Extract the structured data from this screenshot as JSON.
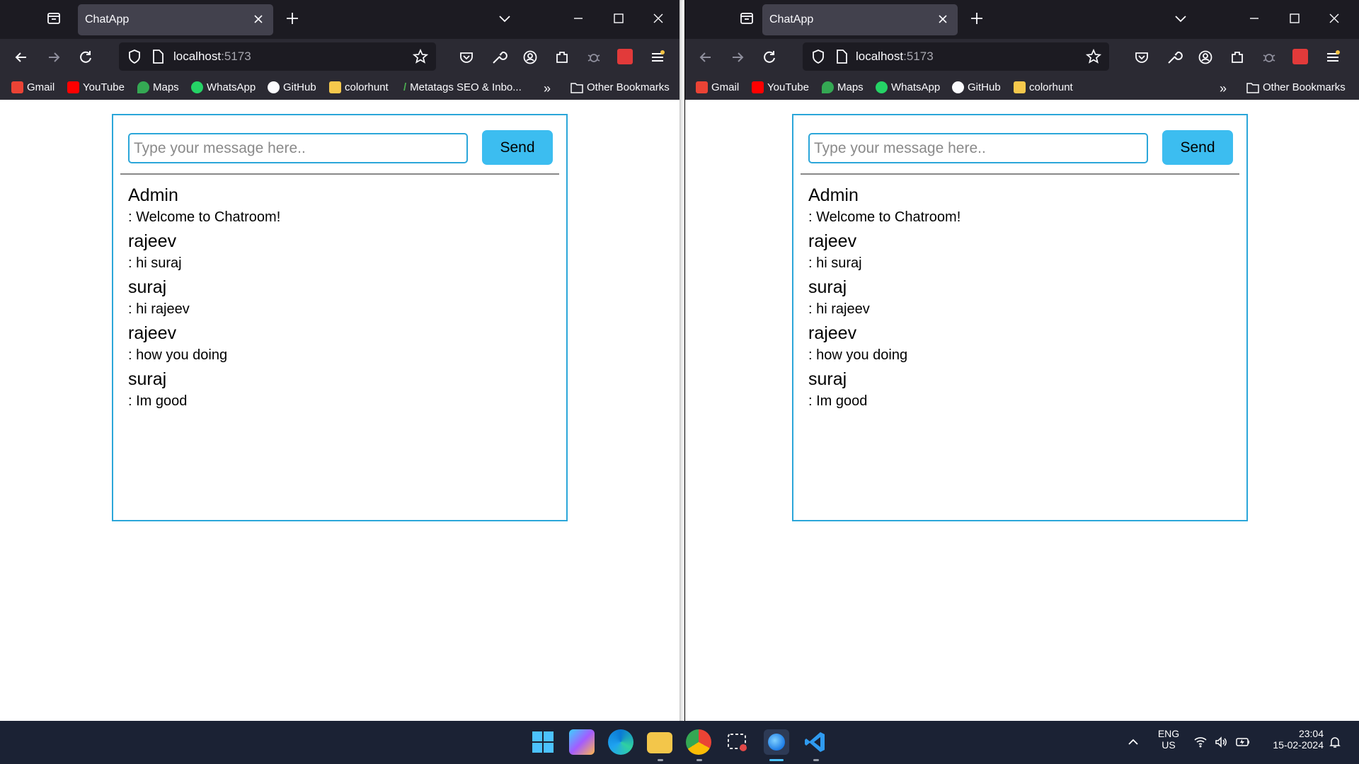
{
  "browser": {
    "tab_title": "ChatApp",
    "url_host": "localhost",
    "url_port": ":5173"
  },
  "bookmarks_left": [
    "Gmail",
    "YouTube",
    "Maps",
    "WhatsApp",
    "GitHub",
    "colorhunt",
    "Metatags SEO & Inbo..."
  ],
  "bookmarks_right": [
    "Gmail",
    "YouTube",
    "Maps",
    "WhatsApp",
    "GitHub",
    "colorhunt"
  ],
  "other_bookmarks": "Other Bookmarks",
  "chat": {
    "placeholder": "Type your message here..",
    "send_label": "Send",
    "messages": [
      {
        "name": "Admin",
        "text": ": Welcome to Chatroom!"
      },
      {
        "name": "rajeev",
        "text": ": hi suraj"
      },
      {
        "name": "suraj",
        "text": ": hi rajeev"
      },
      {
        "name": "rajeev",
        "text": ": how you doing"
      },
      {
        "name": "suraj",
        "text": ": Im good"
      }
    ]
  },
  "taskbar": {
    "lang": "ENG",
    "region": "US",
    "time": "23:04",
    "date": "15-02-2024"
  },
  "icons": [
    "tab-view-icon",
    "close-icon",
    "plus-icon",
    "chevron-down-icon",
    "minimize-icon",
    "maximize-icon",
    "back-icon",
    "forward-icon",
    "reload-icon",
    "shield-icon",
    "page-icon",
    "star-icon",
    "pocket-icon",
    "wrench-icon",
    "account-icon",
    "extensions-icon",
    "menu-icon",
    "folder-icon",
    "windows-start-icon",
    "notification-icon"
  ]
}
